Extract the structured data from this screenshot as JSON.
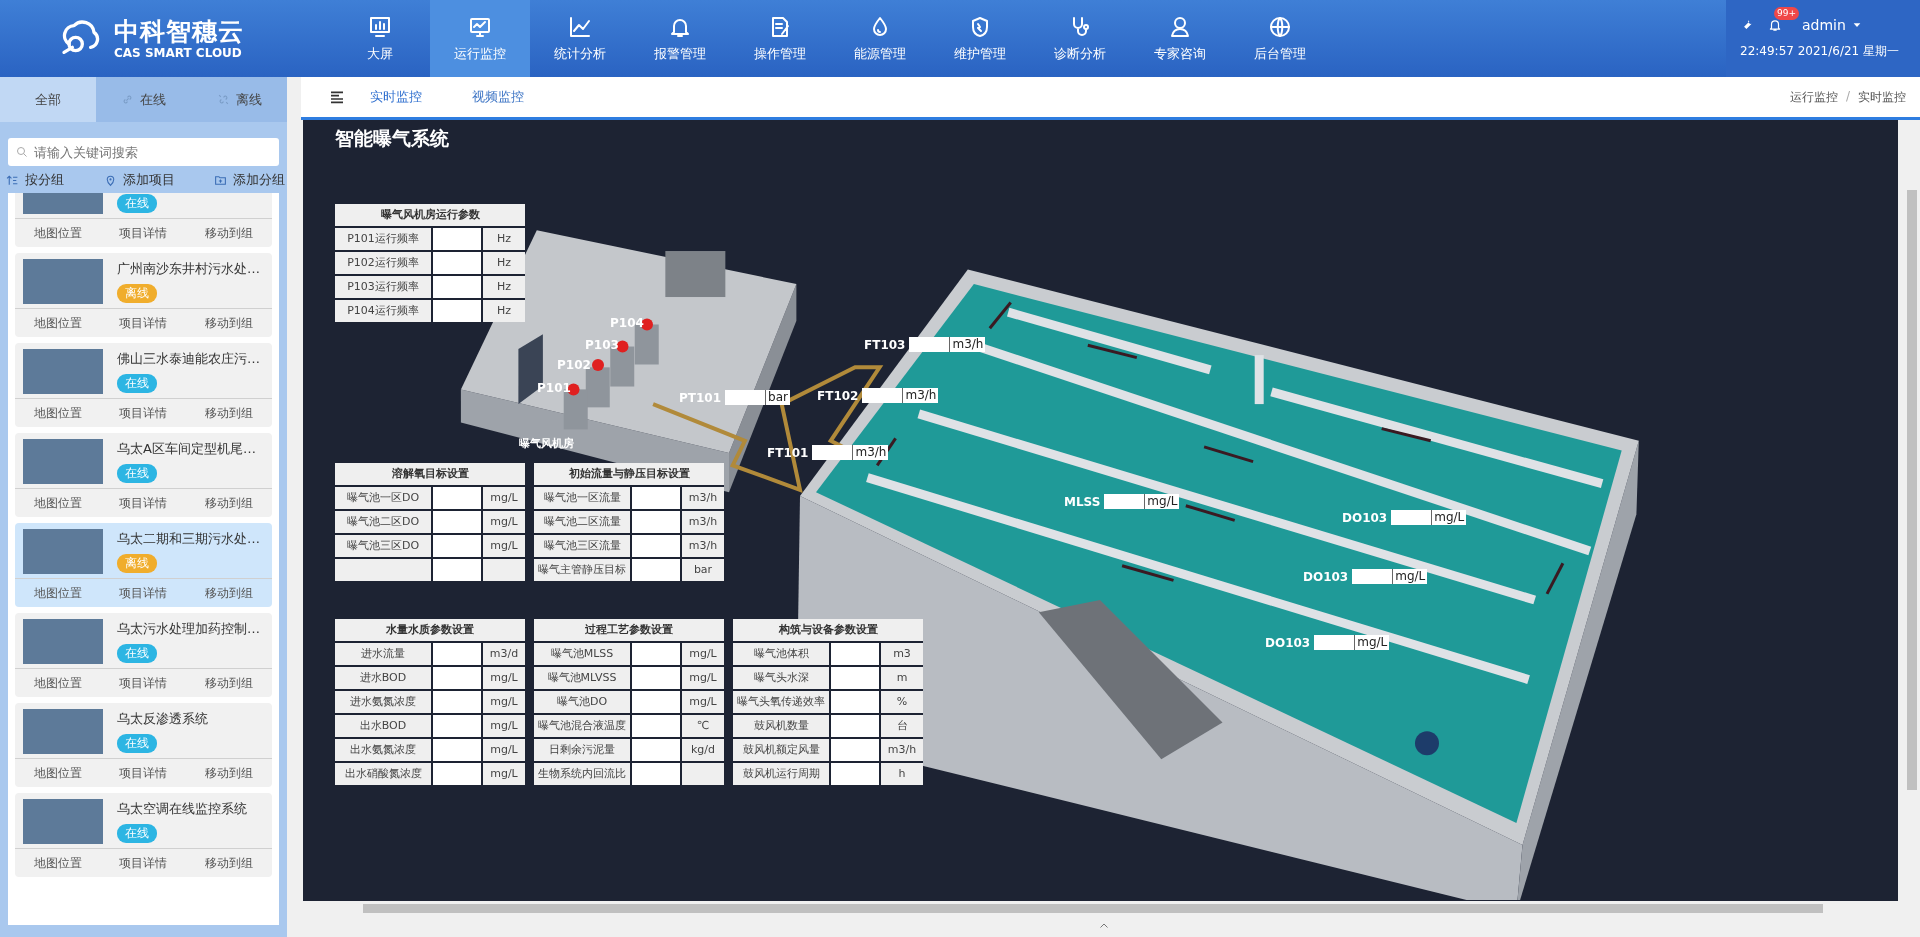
{
  "header": {
    "logo_text": "中科智穗云",
    "logo_subtext": "CAS SMART CLOUD",
    "nav": [
      {
        "label": "大屏",
        "selected": false
      },
      {
        "label": "运行监控",
        "selected": true
      },
      {
        "label": "统计分析",
        "selected": false
      },
      {
        "label": "报警管理",
        "selected": false
      },
      {
        "label": "操作管理",
        "selected": false
      },
      {
        "label": "能源管理",
        "selected": false
      },
      {
        "label": "维护管理",
        "selected": false
      },
      {
        "label": "诊断分析",
        "selected": false
      },
      {
        "label": "专家咨询",
        "selected": false
      },
      {
        "label": "后台管理",
        "selected": false
      }
    ],
    "notification_badge": "99+",
    "user": "admin",
    "datetime": "22:49:57 2021/6/21 星期一"
  },
  "sidebar": {
    "tabs": [
      {
        "label": "全部",
        "selected": true
      },
      {
        "label": "在线",
        "selected": false
      },
      {
        "label": "离线",
        "selected": false
      }
    ],
    "search": {
      "placeholder": "请输入关键词搜索"
    },
    "actions": [
      "按分组",
      "添加项目",
      "添加分组"
    ],
    "projects": [
      {
        "badge": {
          "text": "在线",
          "color": "#2cb5e3"
        },
        "selected": false,
        "actions": [
          "地图位置",
          "项目详情",
          "移动到组"
        ]
      },
      {
        "title": "广州南沙东井村污水处…",
        "badge": {
          "text": "离线",
          "color": "#f0ad2c"
        },
        "selected": false,
        "actions": [
          "地图位置",
          "项目详情",
          "移动到组"
        ]
      },
      {
        "title": "佛山三水泰迪能农庄污…",
        "badge": {
          "text": "在线",
          "color": "#2cb5e3"
        },
        "selected": false,
        "actions": [
          "地图位置",
          "项目详情",
          "移动到组"
        ]
      },
      {
        "title": "乌太A区车间定型机尾…",
        "badge": {
          "text": "在线",
          "color": "#2cb5e3"
        },
        "selected": false,
        "actions": [
          "地图位置",
          "项目详情",
          "移动到组"
        ]
      },
      {
        "title": "乌太二期和三期污水处…",
        "badge": {
          "text": "离线",
          "color": "#f0ad2c"
        },
        "selected": true,
        "actions": [
          "地图位置",
          "项目详情",
          "移动到组"
        ]
      },
      {
        "title": "乌太污水处理加药控制…",
        "badge": {
          "text": "在线",
          "color": "#2cb5e3"
        },
        "selected": false,
        "actions": [
          "地图位置",
          "项目详情",
          "移动到组"
        ]
      },
      {
        "title": "乌太反渗透系统",
        "badge": {
          "text": "在线",
          "color": "#2cb5e3"
        },
        "selected": false,
        "actions": [
          "地图位置",
          "项目详情",
          "移动到组"
        ]
      },
      {
        "title": "乌太空调在线监控系统",
        "badge": {
          "text": "在线",
          "color": "#2cb5e3"
        },
        "selected": false,
        "actions": [
          "地图位置",
          "项目详情",
          "移动到组"
        ]
      }
    ]
  },
  "main": {
    "tabs": [
      {
        "label": "实时监控",
        "selected": true
      },
      {
        "label": "视频监控",
        "selected": false
      }
    ],
    "breadcrumb": [
      "运行监控",
      "实时监控"
    ],
    "breadcrumb_separator": "/",
    "panel": {
      "title": "智能曝气系统",
      "tables": [
        {
          "title": "曝气风机房运行参数",
          "rows": [
            {
              "label": "P101运行频率",
              "unit": "Hz"
            },
            {
              "label": "P102运行频率",
              "unit": "Hz"
            },
            {
              "label": "P103运行频率",
              "unit": "Hz"
            },
            {
              "label": "P104运行频率",
              "unit": "Hz"
            }
          ]
        },
        {
          "title": "溶解氧目标设置",
          "rows": [
            {
              "label": "曝气池一区DO",
              "unit": "mg/L"
            },
            {
              "label": "曝气池二区DO",
              "unit": "mg/L"
            },
            {
              "label": "曝气池三区DO",
              "unit": "mg/L"
            },
            {}
          ]
        },
        {
          "title": "初始流量与静压目标设置",
          "rows": [
            {
              "label": "曝气池一区流量",
              "unit": "m3/h"
            },
            {
              "label": "曝气池二区流量",
              "unit": "m3/h"
            },
            {
              "label": "曝气池三区流量",
              "unit": "m3/h"
            },
            {
              "label": "曝气主管静压目标",
              "unit": "bar"
            }
          ]
        },
        {
          "title": "水量水质参数设置",
          "rows": [
            {
              "label": "进水流量",
              "unit": "m3/d"
            },
            {
              "label": "进水BOD",
              "unit": "mg/L"
            },
            {
              "label": "进水氨氮浓度",
              "unit": "mg/L"
            },
            {
              "label": "出水BOD",
              "unit": "mg/L"
            },
            {
              "label": "出水氨氮浓度",
              "unit": "mg/L"
            },
            {
              "label": "出水硝酸氮浓度",
              "unit": "mg/L"
            }
          ]
        },
        {
          "title": "过程工艺参数设置",
          "rows": [
            {
              "label": "曝气池MLSS",
              "unit": "mg/L"
            },
            {
              "label": "曝气池MLVSS",
              "unit": "mg/L"
            },
            {
              "label": "曝气池DO",
              "unit": "mg/L"
            },
            {
              "label": "曝气池混合液温度",
              "unit": "℃"
            },
            {
              "label": "日剩余污泥量",
              "unit": "kg/d"
            },
            {
              "label": "生物系统内回流比"
            }
          ]
        },
        {
          "title": "构筑与设备参数设置",
          "rows": [
            {
              "label": "曝气池体积",
              "unit": "m3"
            },
            {
              "label": "曝气头水深",
              "unit": "m"
            },
            {
              "label": "曝气头氧传递效率",
              "unit": "%"
            },
            {
              "label": "鼓风机数量",
              "unit": "台"
            },
            {
              "label": "鼓风机额定风量",
              "unit": "m3/h"
            },
            {
              "label": "鼓风机运行周期",
              "unit": "h"
            }
          ]
        }
      ],
      "room_label": "曝气风机房",
      "pumps": [
        "P104",
        "P103",
        "P102",
        "P101"
      ],
      "readings": [
        {
          "label": "PT101",
          "unit": "bar"
        },
        {
          "label": "FT103",
          "unit": "m3/h"
        },
        {
          "label": "FT102",
          "unit": "m3/h"
        },
        {
          "label": "FT101",
          "unit": "m3/h"
        },
        {
          "label": "MLSS",
          "unit": "mg/L"
        },
        {
          "label": "DO103",
          "unit": "mg/L"
        },
        {
          "label": "DO103",
          "unit": "mg/L"
        },
        {
          "label": "DO103",
          "unit": "mg/L"
        }
      ]
    }
  }
}
